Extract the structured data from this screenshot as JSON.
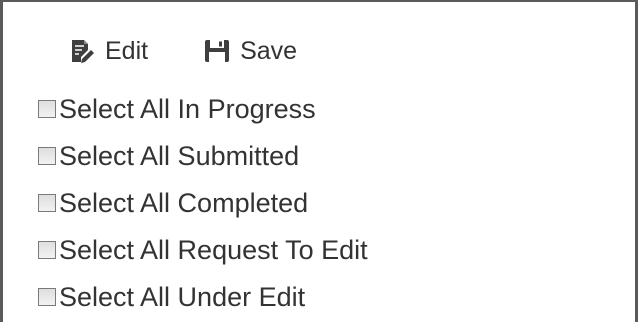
{
  "toolbar": {
    "edit": {
      "label": "Edit",
      "icon": "edit-document-icon"
    },
    "save": {
      "label": "Save",
      "icon": "save-floppy-icon"
    }
  },
  "checkboxes": [
    {
      "label": "Select All In Progress",
      "checked": false
    },
    {
      "label": "Select All Submitted",
      "checked": false
    },
    {
      "label": "Select All Completed",
      "checked": false
    },
    {
      "label": "Select All Request To Edit",
      "checked": false
    },
    {
      "label": "Select All Under Edit",
      "checked": false
    }
  ],
  "colors": {
    "text": "#333333",
    "icon": "#3f3f3f",
    "border": "#5a5a5a"
  }
}
